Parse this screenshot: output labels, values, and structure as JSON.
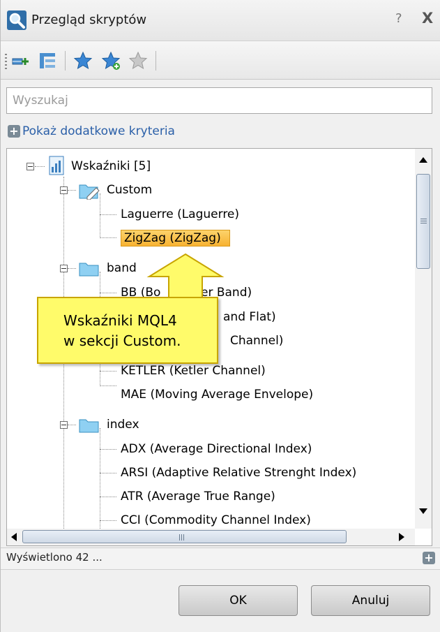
{
  "window": {
    "title": "Przegląd skryptów",
    "help": "?",
    "close": "X"
  },
  "toolbar": {
    "buttons": [
      "add-script-icon",
      "tree-view-icon",
      "favorite-star-icon",
      "add-favorite-icon",
      "remove-favorite-icon"
    ]
  },
  "search": {
    "placeholder": "Wyszukaj",
    "value": ""
  },
  "more_criteria": "Pokaż dodatkowe kryteria",
  "tree": {
    "root": "Wskaźniki [5]",
    "folders": [
      {
        "label": "Custom",
        "items": [
          "Laguerre (Laguerre)",
          "ZigZag (ZigZag)"
        ]
      },
      {
        "label": "band",
        "items": [
          "BB (Bollinger Band)",
          "(Band Flat)",
          "(… Channel)",
          "KETLER (Ketler Channel)",
          "MAE (Moving Average Envelope)"
        ]
      },
      {
        "label": "index",
        "items": [
          "ADX (Average Directional Index)",
          "ARSI (Adaptive Relative Strenght Index)",
          "ATR (Average True Range)",
          "CCI (Commodity Channel Index)"
        ]
      }
    ],
    "band_visible_fragments": [
      "BB (Bo",
      "er Band)",
      "and Flat)",
      "Channel)"
    ],
    "selected": "ZigZag (ZigZag)"
  },
  "callout": {
    "line1": "Wskaźniki  MQL4",
    "line2": "w sekcji Custom."
  },
  "status": {
    "text": "Wyświetlono 42 ..."
  },
  "buttons": {
    "ok": "OK",
    "cancel": "Anuluj"
  },
  "colors": {
    "selection": "#f7b232",
    "callout": "#fffb6a",
    "link": "#2a5fa8",
    "folder": "#7fc4ec"
  }
}
